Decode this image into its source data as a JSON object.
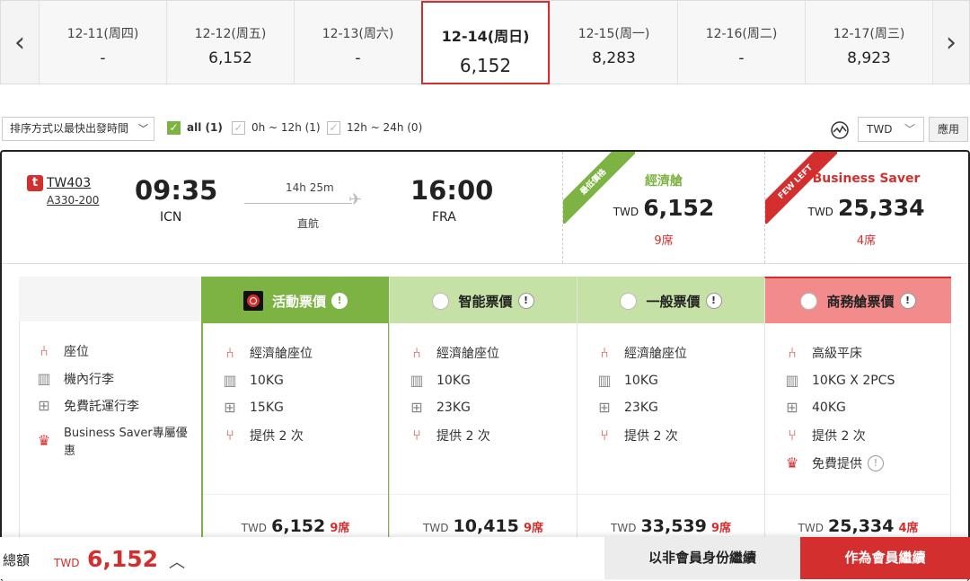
{
  "date_bar": {
    "prev_icon": "chevron-left-icon",
    "next_icon": "chevron-right-icon",
    "dates": [
      {
        "date": "12-11(周四)",
        "price": "-"
      },
      {
        "date": "12-12(周五)",
        "price": "6,152"
      },
      {
        "date": "12-13(周六)",
        "price": "-"
      },
      {
        "date": "12-14(周日)",
        "price": "6,152",
        "active": true
      },
      {
        "date": "12-15(周一)",
        "price": "8,283"
      },
      {
        "date": "12-16(周二)",
        "price": "-"
      },
      {
        "date": "12-17(周三)",
        "price": "8,923"
      }
    ]
  },
  "filters": {
    "sort_label": "排序方式以最快出發時間",
    "time_filters": [
      {
        "label": "all (1)",
        "checked": true
      },
      {
        "label": "0h ~ 12h (1)",
        "checked": false
      },
      {
        "label": "12h ~ 24h (0)",
        "checked": false
      }
    ],
    "currency": "TWD",
    "apply_label": "應用"
  },
  "flight": {
    "flight_no": "TW403",
    "aircraft": "A330-200",
    "depart_time": "09:35",
    "depart_airport": "ICN",
    "duration": "14h 25m",
    "stops": "直航",
    "arrive_time": "16:00",
    "arrive_airport": "FRA",
    "cabins": [
      {
        "ribbon": "最低價格",
        "name": "經濟艙",
        "currency": "TWD",
        "price": "6,152",
        "seats": "9席"
      },
      {
        "ribbon": "FEW LEFT",
        "name": "Business Saver",
        "currency": "TWD",
        "price": "25,334",
        "seats": "4席"
      }
    ]
  },
  "fare_table": {
    "features": [
      "座位",
      "機內行李",
      "免費託運行李",
      "Business Saver專屬優惠"
    ],
    "fares": [
      {
        "name": "活動票價",
        "selected": true,
        "seat": "經濟艙座位",
        "cabin_bag": "10KG",
        "checked_bag": "15KG",
        "meal": "提供 2 次",
        "currency": "TWD",
        "price": "6,152",
        "seats": "9席"
      },
      {
        "name": "智能票價",
        "selected": false,
        "seat": "經濟艙座位",
        "cabin_bag": "10KG",
        "checked_bag": "23KG",
        "meal": "提供 2 次",
        "currency": "TWD",
        "price": "10,415",
        "seats": "9席"
      },
      {
        "name": "一般票價",
        "selected": false,
        "seat": "經濟艙座位",
        "cabin_bag": "10KG",
        "checked_bag": "23KG",
        "meal": "提供 2 次",
        "currency": "TWD",
        "price": "33,539",
        "seats": "9席"
      },
      {
        "name": "商務艙票價",
        "selected": false,
        "seat": "高級平床",
        "cabin_bag": "10KG X 2PCS",
        "checked_bag": "40KG",
        "meal": "提供 2 次",
        "perk": "免費提供",
        "currency": "TWD",
        "price": "25,334",
        "seats": "4席"
      }
    ]
  },
  "footer": {
    "total_label": "總額",
    "currency": "TWD",
    "total": "6,152",
    "guest_button": "以非會員身份繼續",
    "member_button": "作為會員繼續"
  },
  "colors": {
    "brand_red": "#d32f2f",
    "promo_green": "#7cb342",
    "smart_green": "#c5e1a5",
    "biz_pink": "#f28b8b"
  }
}
